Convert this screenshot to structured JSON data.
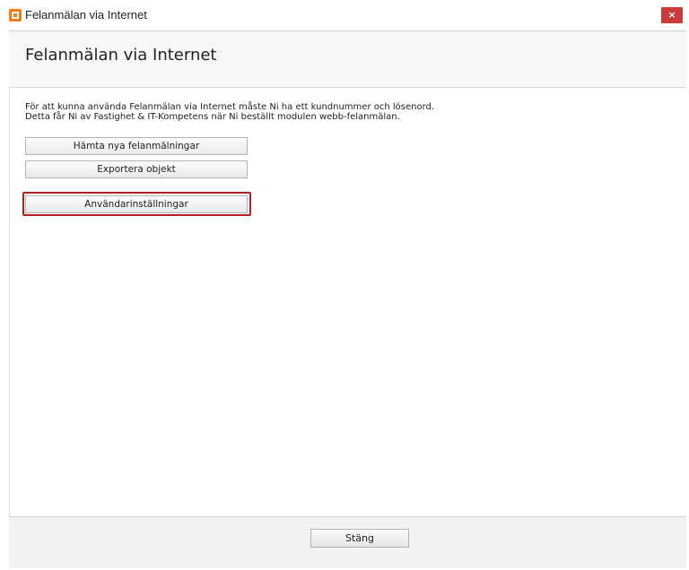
{
  "window": {
    "title": "Felanmälan via Internet",
    "close_glyph": "×",
    "app_icon": "app-logo-icon"
  },
  "header": {
    "title": "Felanmälan via Internet"
  },
  "main": {
    "description": [
      "För att kunna använda Felanmälan via Internet måste Ni ha ett kundnummer och lösenord.",
      "Detta får Ni av Fastighet & IT-Kompetens när Ni beställt modulen webb-felanmälan."
    ],
    "buttons": {
      "fetch": "Hämta nya felanmälningar",
      "export": "Exportera objekt",
      "user_settings": "Användarinställningar"
    }
  },
  "footer": {
    "close_label": "Stäng"
  },
  "colors": {
    "highlight_border": "#b02020",
    "close_button_bg": "#c93a3a",
    "app_icon": "#f07c1e"
  }
}
